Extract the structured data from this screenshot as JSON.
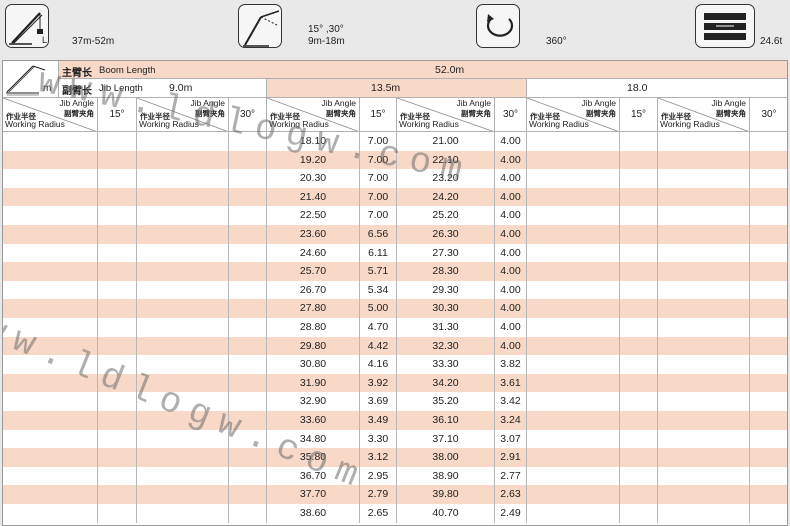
{
  "topbar": {
    "boom_range": "37m-52m",
    "jib_angles": "15° ,30°",
    "jib_range": "9m-18m",
    "slew": "360°",
    "counterweight": "24.6t",
    "icons": [
      "boom-crane-icon",
      "luffing-jib-icon",
      "rotation-icon",
      "counterweight-icon"
    ]
  },
  "table": {
    "boom_length_cn": "主臂长",
    "boom_length_en": "Boom Length",
    "boom_length_value": "52.0m",
    "jib_length_cn": "副臂长",
    "jib_length_en": "Jib Length",
    "jib_lengths": [
      "9.0m",
      "13.5m",
      "18.0"
    ],
    "unit_label": "m",
    "column_header": {
      "jib_angle_en": "Jib Angle",
      "jib_angle_cn": "副臂夹角",
      "radius_cn": "作业半径",
      "radius_en": "Working Radius"
    },
    "angles": [
      "15°",
      "30°",
      "15°",
      "30°",
      "15°",
      "30°"
    ],
    "rows": [
      [
        "18.10",
        "7.00",
        "21.00",
        "4.00"
      ],
      [
        "19.20",
        "7.00",
        "22.10",
        "4.00"
      ],
      [
        "20.30",
        "7.00",
        "23.20",
        "4.00"
      ],
      [
        "21.40",
        "7.00",
        "24.20",
        "4.00"
      ],
      [
        "22.50",
        "7.00",
        "25.20",
        "4.00"
      ],
      [
        "23.60",
        "6.56",
        "26.30",
        "4.00"
      ],
      [
        "24.60",
        "6.11",
        "27.30",
        "4.00"
      ],
      [
        "25.70",
        "5.71",
        "28.30",
        "4.00"
      ],
      [
        "26.70",
        "5.34",
        "29.30",
        "4.00"
      ],
      [
        "27.80",
        "5.00",
        "30.30",
        "4.00"
      ],
      [
        "28.80",
        "4.70",
        "31.30",
        "4.00"
      ],
      [
        "29.80",
        "4.42",
        "32.30",
        "4.00"
      ],
      [
        "30.80",
        "4.16",
        "33.30",
        "3.82"
      ],
      [
        "31.90",
        "3.92",
        "34.20",
        "3.61"
      ],
      [
        "32.90",
        "3.69",
        "35.20",
        "3.42"
      ],
      [
        "33.60",
        "3.49",
        "36.10",
        "3.24"
      ],
      [
        "34.80",
        "3.30",
        "37.10",
        "3.07"
      ],
      [
        "35.80",
        "3.12",
        "38.00",
        "2.91"
      ],
      [
        "36.70",
        "2.95",
        "38.90",
        "2.77"
      ],
      [
        "37.70",
        "2.79",
        "39.80",
        "2.63"
      ],
      [
        "38.60",
        "2.65",
        "40.70",
        "2.49"
      ]
    ]
  },
  "watermark": "www.ldlogw.com",
  "colors": {
    "stripe": "#f8d8c6",
    "grid": "#b0b0b0",
    "header_bg": "#e9e9e9"
  }
}
